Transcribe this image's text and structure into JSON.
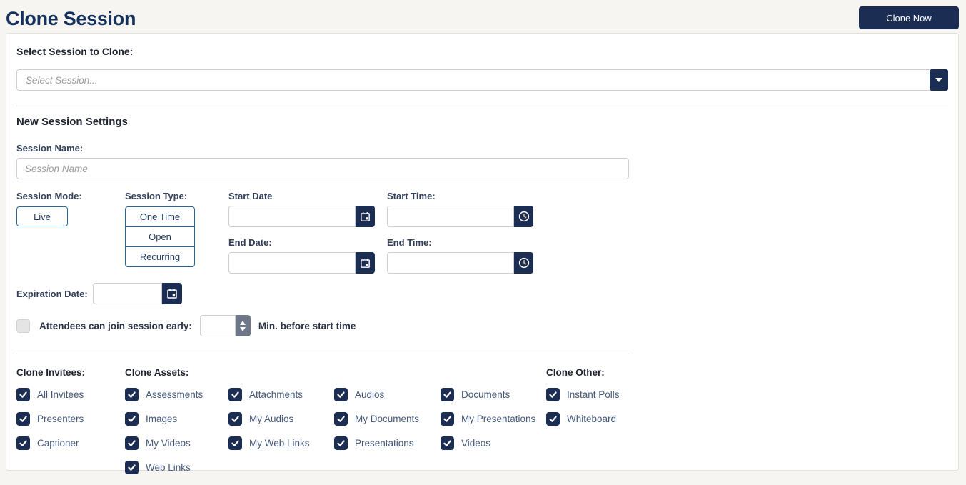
{
  "page": {
    "title": "Clone Session"
  },
  "header": {
    "clone_now": "Clone Now"
  },
  "select_session": {
    "label": "Select Session to Clone:",
    "placeholder": "Select Session...",
    "value": ""
  },
  "settings": {
    "heading": "New Session Settings",
    "session_name_label": "Session Name:",
    "session_name_placeholder": "Session Name",
    "session_name_value": "",
    "session_mode_label": "Session Mode:",
    "session_mode_options": [
      "Live"
    ],
    "session_type_label": "Session Type:",
    "session_type_options": [
      "One Time",
      "Open",
      "Recurring"
    ],
    "start_date_label": "Start Date",
    "start_date_value": "",
    "start_time_label": "Start Time:",
    "start_time_value": "",
    "end_date_label": "End Date:",
    "end_date_value": "",
    "end_time_label": "End Time:",
    "end_time_value": "",
    "expiration_date_label": "Expiration Date:",
    "expiration_date_value": "",
    "join_early_label": "Attendees can join session early:",
    "join_early_checked": false,
    "join_early_minutes_value": "",
    "join_early_suffix": "Min. before start time"
  },
  "clone": {
    "sections": [
      {
        "heading": "Clone Invitees:",
        "items": [
          {
            "label": "All Invitees",
            "checked": true
          },
          {
            "label": "Presenters",
            "checked": true
          },
          {
            "label": "Captioner",
            "checked": true
          }
        ]
      },
      {
        "heading": "Clone Assets:",
        "items": [
          {
            "label": "Assessments",
            "checked": true
          },
          {
            "label": "Images",
            "checked": true
          },
          {
            "label": "My Videos",
            "checked": true
          },
          {
            "label": "Web Links",
            "checked": true
          }
        ]
      },
      {
        "heading": "",
        "items": [
          {
            "label": "Attachments",
            "checked": true
          },
          {
            "label": "My Audios",
            "checked": true
          },
          {
            "label": "My Web Links",
            "checked": true
          }
        ]
      },
      {
        "heading": "",
        "items": [
          {
            "label": "Audios",
            "checked": true
          },
          {
            "label": "My Documents",
            "checked": true
          },
          {
            "label": "Presentations",
            "checked": true
          }
        ]
      },
      {
        "heading": "",
        "items": [
          {
            "label": "Documents",
            "checked": true
          },
          {
            "label": "My Presentations",
            "checked": true
          },
          {
            "label": "Videos",
            "checked": true
          }
        ]
      },
      {
        "heading": "Clone Other:",
        "items": [
          {
            "label": "Instant Polls",
            "checked": true
          },
          {
            "label": "Whiteboard",
            "checked": true
          }
        ]
      }
    ]
  },
  "colors": {
    "brand_navy": "#1b2d52",
    "title_navy": "#16325c",
    "button_border_blue": "#2368a2",
    "checkbox_label": "#44597c",
    "page_background": "#f7f5f2"
  }
}
